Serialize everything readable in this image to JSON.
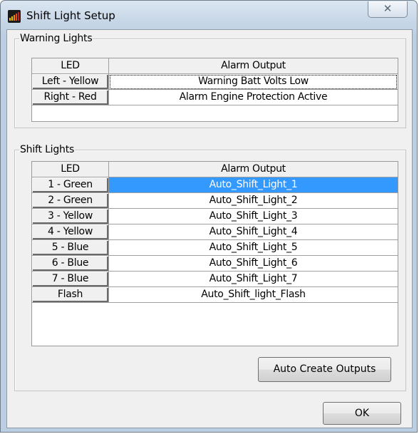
{
  "window": {
    "title": "Shift Light Setup",
    "close_glyph": "✕"
  },
  "warning_lights": {
    "label": "Warning Lights",
    "headers": {
      "led": "LED",
      "output": "Alarm Output"
    },
    "rows": [
      {
        "led": "Left - Yellow",
        "output": "Warning Batt Volts Low"
      },
      {
        "led": "Right - Red",
        "output": "Alarm Engine Protection Active"
      }
    ]
  },
  "shift_lights": {
    "label": "Shift Lights",
    "headers": {
      "led": "LED",
      "output": "Alarm Output"
    },
    "rows": [
      {
        "led": "1 - Green",
        "output": "Auto_Shift_Light_1"
      },
      {
        "led": "2 - Green",
        "output": "Auto_Shift_Light_2"
      },
      {
        "led": "3 - Yellow",
        "output": "Auto_Shift_Light_3"
      },
      {
        "led": "4 - Yellow",
        "output": "Auto_Shift_Light_4"
      },
      {
        "led": "5 - Blue",
        "output": "Auto_Shift_Light_5"
      },
      {
        "led": "6 - Blue",
        "output": "Auto_Shift_Light_6"
      },
      {
        "led": "7 - Blue",
        "output": "Auto_Shift_Light_7"
      },
      {
        "led": "Flash",
        "output": "Auto_Shift_light_Flash"
      }
    ]
  },
  "buttons": {
    "auto_create": "Auto Create Outputs",
    "ok": "OK"
  },
  "colors": {
    "selection": "#3399ff",
    "dialog_bg": "#f0f0f0",
    "titlebar": "#c9d8e8"
  }
}
